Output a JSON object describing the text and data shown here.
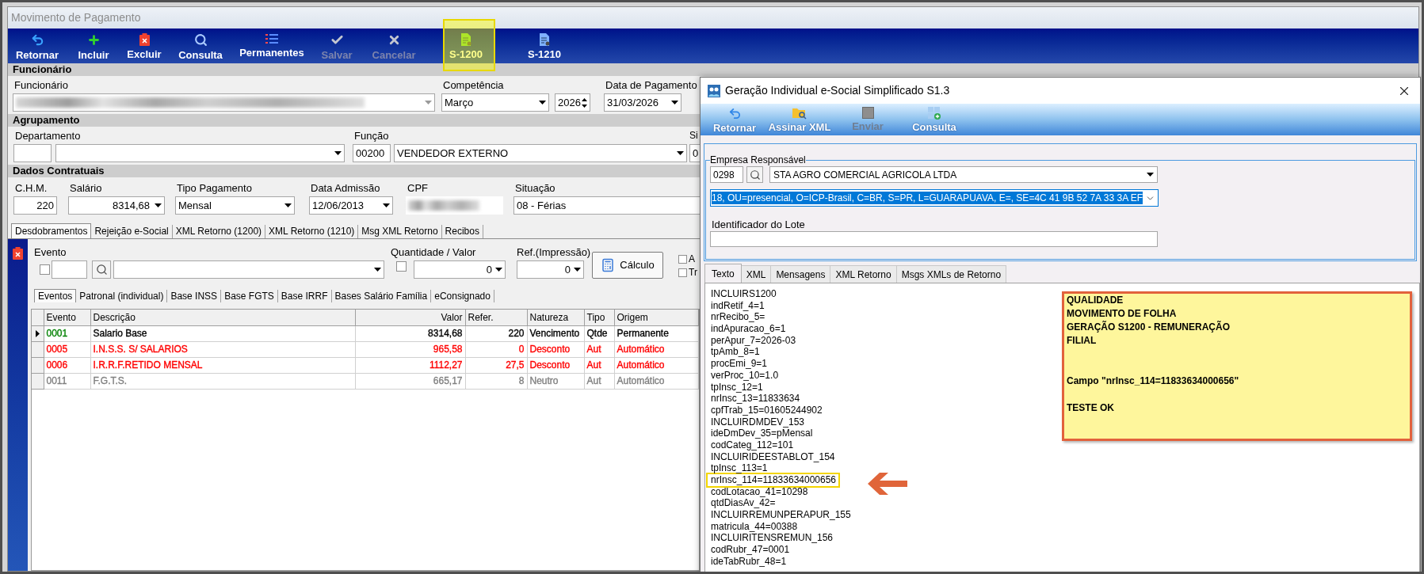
{
  "window": {
    "title": "Movimento de Pagamento"
  },
  "toolbar": [
    {
      "label": "Retornar",
      "disabled": false,
      "highlighted": false
    },
    {
      "label": "Incluir",
      "disabled": false,
      "highlighted": false
    },
    {
      "label": "Excluir",
      "disabled": false,
      "highlighted": false
    },
    {
      "label": "Consulta",
      "disabled": false,
      "highlighted": false
    },
    {
      "label": "Permanentes",
      "disabled": false,
      "highlighted": false
    },
    {
      "label": "Salvar",
      "disabled": true,
      "highlighted": false
    },
    {
      "label": "Cancelar",
      "disabled": true,
      "highlighted": false
    },
    {
      "label": "S-1200",
      "disabled": false,
      "highlighted": true
    },
    {
      "label": "S-1210",
      "disabled": false,
      "highlighted": false
    }
  ],
  "funcionario": {
    "header": "Funcionário",
    "employee_label": "Funcionário",
    "competencia_label": "Competência",
    "month": "Março",
    "year": "2026",
    "payment_date_label": "Data de Pagamento",
    "payment_date": "31/03/2026"
  },
  "agrupamento": {
    "header": "Agrupamento",
    "department_label": "Departamento",
    "function_label": "Função",
    "function_code": "00200",
    "function_name": "VENDEDOR EXTERNO",
    "column_3_label": "Si",
    "column_3_value": "0"
  },
  "dados_contratuais": {
    "header": "Dados Contratuais",
    "fields": [
      {
        "label": "C.H.M.",
        "value": "220",
        "kind": "number"
      },
      {
        "label": "Salário",
        "value": "8314,68",
        "kind": "number_dropdown"
      },
      {
        "label": "Tipo Pagamento",
        "value": "Mensal",
        "kind": "dropdown"
      },
      {
        "label": "Data Admissão",
        "value": "12/06/2013",
        "kind": "dropdown"
      },
      {
        "label": "CPF",
        "kind": "redacted"
      },
      {
        "label": "Situação",
        "value": "08 - Férias",
        "kind": "text"
      }
    ]
  },
  "tabs": [
    {
      "label": "Desdobramentos",
      "selected": true
    },
    {
      "label": "Rejeição e-Social",
      "selected": false
    },
    {
      "label": "XML Retorno (1200)",
      "selected": false
    },
    {
      "label": "XML Retorno (1210)",
      "selected": false
    },
    {
      "label": "Msg XML Retorno",
      "selected": false
    },
    {
      "label": "Recibos",
      "selected": false
    }
  ],
  "evento_panel": {
    "evento_label": "Evento",
    "evento_checked": false,
    "quantity_label": "Quantidade / Valor",
    "quantity_checked": false,
    "quantity_value": "0",
    "reference_label": "Ref.(Impressão)",
    "reference_value": "0",
    "calculate_button": "Cálculo",
    "options": [
      {
        "label": "A",
        "checked": false
      },
      {
        "label": "Tr",
        "checked": false
      }
    ]
  },
  "sub_tabs": [
    {
      "label": "Eventos",
      "selected": true
    },
    {
      "label": "Patronal (individual)",
      "selected": false
    },
    {
      "label": "Base INSS",
      "selected": false
    },
    {
      "label": "Base FGTS",
      "selected": false
    },
    {
      "label": "Base IRRF",
      "selected": false
    },
    {
      "label": "Bases Salário Família",
      "selected": false
    },
    {
      "label": "eConsignado",
      "selected": false
    }
  ],
  "grid": {
    "columns": [
      "Evento",
      "Descrição",
      "Valor",
      "Refer.",
      "Natureza",
      "Tipo",
      "Origem"
    ],
    "rows": [
      {
        "selected": true,
        "cells": [
          {
            "text": "0001",
            "color": "#008000"
          },
          {
            "text": "Salario Base",
            "color": "#000000"
          },
          {
            "text": "8314,68",
            "color": "#000000"
          },
          {
            "text": "220",
            "color": "#000000"
          },
          {
            "text": "Vencimento",
            "color": "#000000"
          },
          {
            "text": "Qtde",
            "color": "#000000"
          },
          {
            "text": "Permanente",
            "color": "#000000"
          }
        ]
      },
      {
        "selected": false,
        "cells": [
          {
            "text": "0005",
            "color": "#ff0000"
          },
          {
            "text": "I.N.S.S. S/ SALARIOS",
            "color": "#ff0000"
          },
          {
            "text": "965,58",
            "color": "#ff0000"
          },
          {
            "text": "0",
            "color": "#ff0000"
          },
          {
            "text": "Desconto",
            "color": "#ff0000"
          },
          {
            "text": "Aut",
            "color": "#ff0000"
          },
          {
            "text": "Automático",
            "color": "#ff0000"
          }
        ]
      },
      {
        "selected": false,
        "cells": [
          {
            "text": "0006",
            "color": "#ff0000"
          },
          {
            "text": "I.R.R.F.RETIDO MENSAL",
            "color": "#ff0000"
          },
          {
            "text": "1112,27",
            "color": "#ff0000"
          },
          {
            "text": "27,5",
            "color": "#ff0000"
          },
          {
            "text": "Desconto",
            "color": "#ff0000"
          },
          {
            "text": "Aut",
            "color": "#ff0000"
          },
          {
            "text": "Automático",
            "color": "#ff0000"
          }
        ]
      },
      {
        "selected": false,
        "cells": [
          {
            "text": "0011",
            "color": "#808080"
          },
          {
            "text": "F.G.T.S.",
            "color": "#808080"
          },
          {
            "text": "665,17",
            "color": "#808080"
          },
          {
            "text": "8",
            "color": "#808080"
          },
          {
            "text": "Neutro",
            "color": "#808080"
          },
          {
            "text": "Aut",
            "color": "#808080"
          },
          {
            "text": "Automático",
            "color": "#808080"
          }
        ]
      }
    ]
  },
  "dialog": {
    "title": "Geração Individual e-Social Simplificado S1.3",
    "toolbar": [
      {
        "label": "Retornar",
        "disabled": false
      },
      {
        "label": "Assinar XML",
        "disabled": false
      },
      {
        "label": "Enviar",
        "disabled": true
      },
      {
        "label": "Consulta",
        "disabled": false
      }
    ],
    "company_group": {
      "legend": "Empresa Responsável",
      "code": "0298",
      "company": "STA AGRO COMERCIAL AGRICOLA LTDA",
      "certificate": "18, OU=presencial, O=ICP-Brasil, C=BR, S=PR, L=GUARAPUAVA, E=, SE=4C 41 9B 52 7A 33 3A EF",
      "certificate_selected": true,
      "batch_label": "Identificador do Lote"
    },
    "tabs": [
      {
        "label": "Texto",
        "selected": true
      },
      {
        "label": "XML",
        "selected": false
      },
      {
        "label": "Mensagens",
        "selected": false
      },
      {
        "label": "XML Retorno",
        "selected": false
      },
      {
        "label": "Msgs XMLs de Retorno",
        "selected": false
      }
    ],
    "text_lines": [
      {
        "text": "INCLUIRS1200",
        "highlighted": false
      },
      {
        "text": "indRetif_4=1",
        "highlighted": false
      },
      {
        "text": "nrRecibo_5=",
        "highlighted": false
      },
      {
        "text": "indApuracao_6=1",
        "highlighted": false
      },
      {
        "text": "perApur_7=2026-03",
        "highlighted": false
      },
      {
        "text": "tpAmb_8=1",
        "highlighted": false
      },
      {
        "text": "procEmi_9=1",
        "highlighted": false
      },
      {
        "text": "verProc_10=1.0",
        "highlighted": false
      },
      {
        "text": "tpInsc_12=1",
        "highlighted": false
      },
      {
        "text": "nrInsc_13=11833634",
        "highlighted": false
      },
      {
        "text": "cpfTrab_15=01605244902",
        "highlighted": false
      },
      {
        "text": "INCLUIRDMDEV_153",
        "highlighted": false
      },
      {
        "text": "ideDmDev_35=pMensal",
        "highlighted": false
      },
      {
        "text": "codCateg_112=101",
        "highlighted": false
      },
      {
        "text": "INCLUIRIDEESTABLOT_154",
        "highlighted": false
      },
      {
        "text": "tpInsc_113=1",
        "highlighted": false
      },
      {
        "text": "nrInsc_114=11833634000656",
        "highlighted": true
      },
      {
        "text": "codLotacao_41=10298",
        "highlighted": false
      },
      {
        "text": "qtdDiasAv_42=",
        "highlighted": false
      },
      {
        "text": "INCLUIRREMUNPERAPUR_155",
        "highlighted": false
      },
      {
        "text": "matricula_44=00388",
        "highlighted": false
      },
      {
        "text": "INCLUIRITENSREMUN_156",
        "highlighted": false
      },
      {
        "text": "codRubr_47=0001",
        "highlighted": false
      },
      {
        "text": "ideTabRubr_48=1",
        "highlighted": false
      }
    ],
    "note": {
      "blocks": [
        [
          "QUALIDADE",
          "MOVIMENTO DE FOLHA",
          "GERAÇÃO S1200 - REMUNERAÇÃO",
          "FILIAL"
        ],
        [
          "Campo \"nrInsc_114=11833634000656\""
        ],
        [
          "TESTE OK"
        ]
      ]
    }
  }
}
